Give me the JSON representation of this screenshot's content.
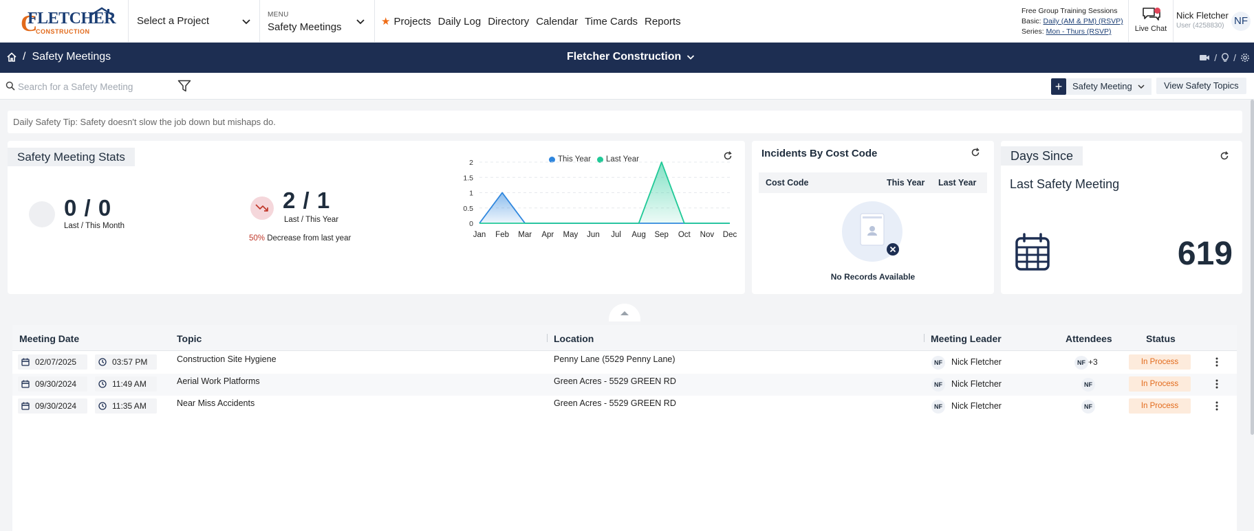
{
  "topbar": {
    "logo_text": "FLETCHER",
    "logo_sub": "CONSTRUCTION",
    "project_select": "Select a Project",
    "menu_small": "MENU",
    "menu_value": "Safety Meetings",
    "nav": [
      "Projects",
      "Daily Log",
      "Directory",
      "Calendar",
      "Time Cards",
      "Reports"
    ],
    "training_title": "Free Group Training Sessions",
    "training_basic_label": "Basic: ",
    "training_basic_link": "Daily (AM & PM) (RSVP)",
    "training_series_label": "Series: ",
    "training_series_link": "Mon - Thurs (RSVP)",
    "live_chat": "Live Chat",
    "user_name": "Nick Fletcher",
    "user_id": "User (4258830)",
    "user_initials": "NF"
  },
  "header": {
    "breadcrumb": "Safety Meetings",
    "company": "Fletcher Construction"
  },
  "toolbar": {
    "search_placeholder": "Search for a Safety Meeting",
    "add_label": "Safety Meeting",
    "view_topics": "View Safety Topics"
  },
  "tip": "Daily Safety Tip: Safety doesn't slow the job down but mishaps do.",
  "stats": {
    "title": "Safety Meeting Stats",
    "month_value": "0 / 0",
    "month_label": "Last / This Month",
    "year_value": "2 / 1",
    "year_label": "Last / This Year",
    "decrease_pct": "50%",
    "decrease_text": " Decrease from last year"
  },
  "chart_data": {
    "type": "area",
    "title": "",
    "xlabel": "",
    "ylabel": "",
    "categories": [
      "Jan",
      "Feb",
      "Mar",
      "Apr",
      "May",
      "Jun",
      "Jul",
      "Aug",
      "Sep",
      "Oct",
      "Nov",
      "Dec"
    ],
    "yticks": [
      "0",
      "0.5",
      "1",
      "1.5",
      "2"
    ],
    "ylim": [
      0,
      2
    ],
    "grid": true,
    "legend_placement": "top",
    "series": [
      {
        "name": "This Year",
        "color": "#2e86de",
        "values": [
          0,
          1,
          0,
          0,
          0,
          0,
          0,
          0,
          0,
          0,
          0,
          0
        ]
      },
      {
        "name": "Last Year",
        "color": "#20c997",
        "values": [
          0,
          0,
          0,
          0,
          0,
          0,
          0,
          0,
          2,
          0,
          0,
          0
        ]
      }
    ]
  },
  "incidents": {
    "title": "Incidents By Cost Code",
    "col_cost_code": "Cost Code",
    "col_this_year": "This Year",
    "col_last_year": "Last Year",
    "empty": "No Records Available"
  },
  "days_since": {
    "title": "Days Since",
    "label": "Last Safety Meeting",
    "value": "619"
  },
  "table": {
    "headers": {
      "date": "Meeting Date",
      "topic": "Topic",
      "location": "Location",
      "leader": "Meeting Leader",
      "attendees": "Attendees",
      "status": "Status"
    },
    "rows": [
      {
        "date": "02/07/2025",
        "time": "03:57 PM",
        "topic": "Construction Site Hygiene",
        "location": "Penny Lane (5529 Penny Lane)",
        "leader_initials": "NF",
        "leader": "Nick Fletcher",
        "attendee_initials": "NF",
        "attendee_extra": "+3",
        "status": "In Process"
      },
      {
        "date": "09/30/2024",
        "time": "11:49 AM",
        "topic": "Aerial Work Platforms",
        "location": "Green Acres - 5529 GREEN RD",
        "leader_initials": "NF",
        "leader": "Nick Fletcher",
        "attendee_initials": "NF",
        "attendee_extra": "",
        "status": "In Process"
      },
      {
        "date": "09/30/2024",
        "time": "11:35 AM",
        "topic": "Near Miss Accidents",
        "location": "Green Acres - 5529 GREEN RD",
        "leader_initials": "NF",
        "leader": "Nick Fletcher",
        "attendee_initials": "NF",
        "attendee_extra": "",
        "status": "In Process"
      }
    ]
  },
  "colors": {
    "navy": "#1d2e52",
    "accent_orange": "#e26a1b",
    "this_year": "#2e86de",
    "last_year": "#20c997"
  }
}
